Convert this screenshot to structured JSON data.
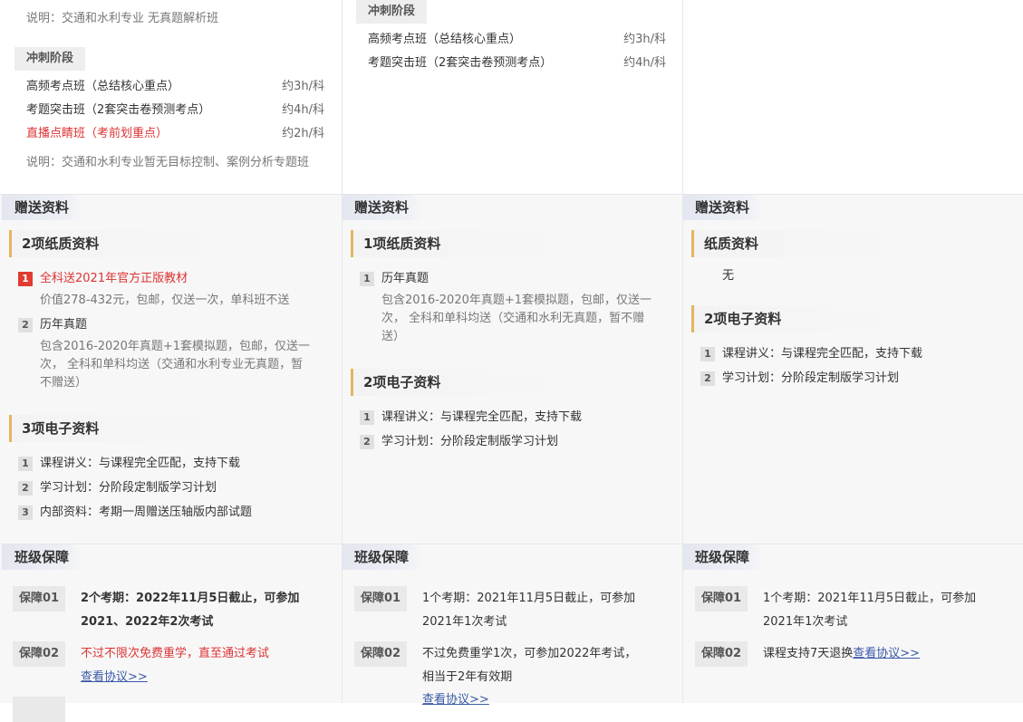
{
  "col0": {
    "top_note": "说明：交通和水利专业 无真题解析班",
    "stage": "冲刺阶段",
    "courses": [
      {
        "name": "高频考点班（总结核心重点）",
        "time": "约3h/科"
      },
      {
        "name": "考题突击班（2套突击卷预测考点）",
        "time": "约4h/科"
      },
      {
        "name": "直播点睛班（考前划重点）",
        "time": "约2h/科"
      }
    ],
    "note": "说明：交通和水利专业暂无目标控制、案例分析专题班",
    "gift_title": "赠送资料",
    "paper_title": "2项纸质资料",
    "paper_items": [
      {
        "n": "1",
        "title": "全科送2021年官方正版教材",
        "desc": "价值278-432元，包邮，仅送一次，单科班不送"
      },
      {
        "n": "2",
        "title": "历年真题",
        "desc1": "包含2016-2020年真题+1套模拟题，包邮，仅送一",
        "desc2": "次， 全科和单科均送（交通和水利专业无真题，暂",
        "desc3": "不赠送）"
      }
    ],
    "e_title": "3项电子资料",
    "e_items": [
      {
        "n": "1",
        "text": "课程讲义：与课程完全匹配，支持下载"
      },
      {
        "n": "2",
        "text": "学习计划：分阶段定制版学习计划"
      },
      {
        "n": "3",
        "text": "内部资料：考期一周赠送压轴版内部试题"
      }
    ],
    "guarantee_title": "班级保障",
    "g": [
      {
        "badge": "保障01",
        "l1": "2个考期：2022年11月5日截止，可参加",
        "l2": "2021、2022年2次考试"
      },
      {
        "badge": "保障02",
        "l1": "不过不限次免费重学，直至通过考试",
        "link": "查看协议>>"
      }
    ]
  },
  "col1": {
    "stage": "冲刺阶段",
    "courses": [
      {
        "name": "高频考点班（总结核心重点）",
        "time": "约3h/科"
      },
      {
        "name": "考题突击班（2套突击卷预测考点）",
        "time": "约4h/科"
      }
    ],
    "gift_title": "赠送资料",
    "paper_title": "1项纸质资料",
    "paper_items": [
      {
        "n": "1",
        "title": "历年真题",
        "desc1": "包含2016-2020年真题+1套模拟题，包邮，仅送一",
        "desc2": "次， 全科和单科均送（交通和水利无真题，暂不赠",
        "desc3": "送）"
      }
    ],
    "e_title": "2项电子资料",
    "e_items": [
      {
        "n": "1",
        "text": "课程讲义：与课程完全匹配，支持下载"
      },
      {
        "n": "2",
        "text": "学习计划：分阶段定制版学习计划"
      }
    ],
    "guarantee_title": "班级保障",
    "g": [
      {
        "badge": "保障01",
        "l1": "1个考期：2021年11月5日截止，可参加",
        "l2": "2021年1次考试"
      },
      {
        "badge": "保障02",
        "l1": "不过免费重学1次，可参加2022年考试，",
        "l2": "相当于2年有效期",
        "link": "查看协议>>"
      }
    ]
  },
  "col2": {
    "gift_title": "赠送资料",
    "paper_title": "纸质资料",
    "paper_none": "无",
    "e_title": "2项电子资料",
    "e_items": [
      {
        "n": "1",
        "text": "课程讲义：与课程完全匹配，支持下载"
      },
      {
        "n": "2",
        "text": "学习计划：分阶段定制版学习计划"
      }
    ],
    "guarantee_title": "班级保障",
    "g": [
      {
        "badge": "保障01",
        "l1": "1个考期：2021年11月5日截止，可参加",
        "l2": "2021年1次考试"
      },
      {
        "badge": "保障02",
        "l1": "课程支持7天退换",
        "link": "查看协议>>"
      }
    ]
  }
}
